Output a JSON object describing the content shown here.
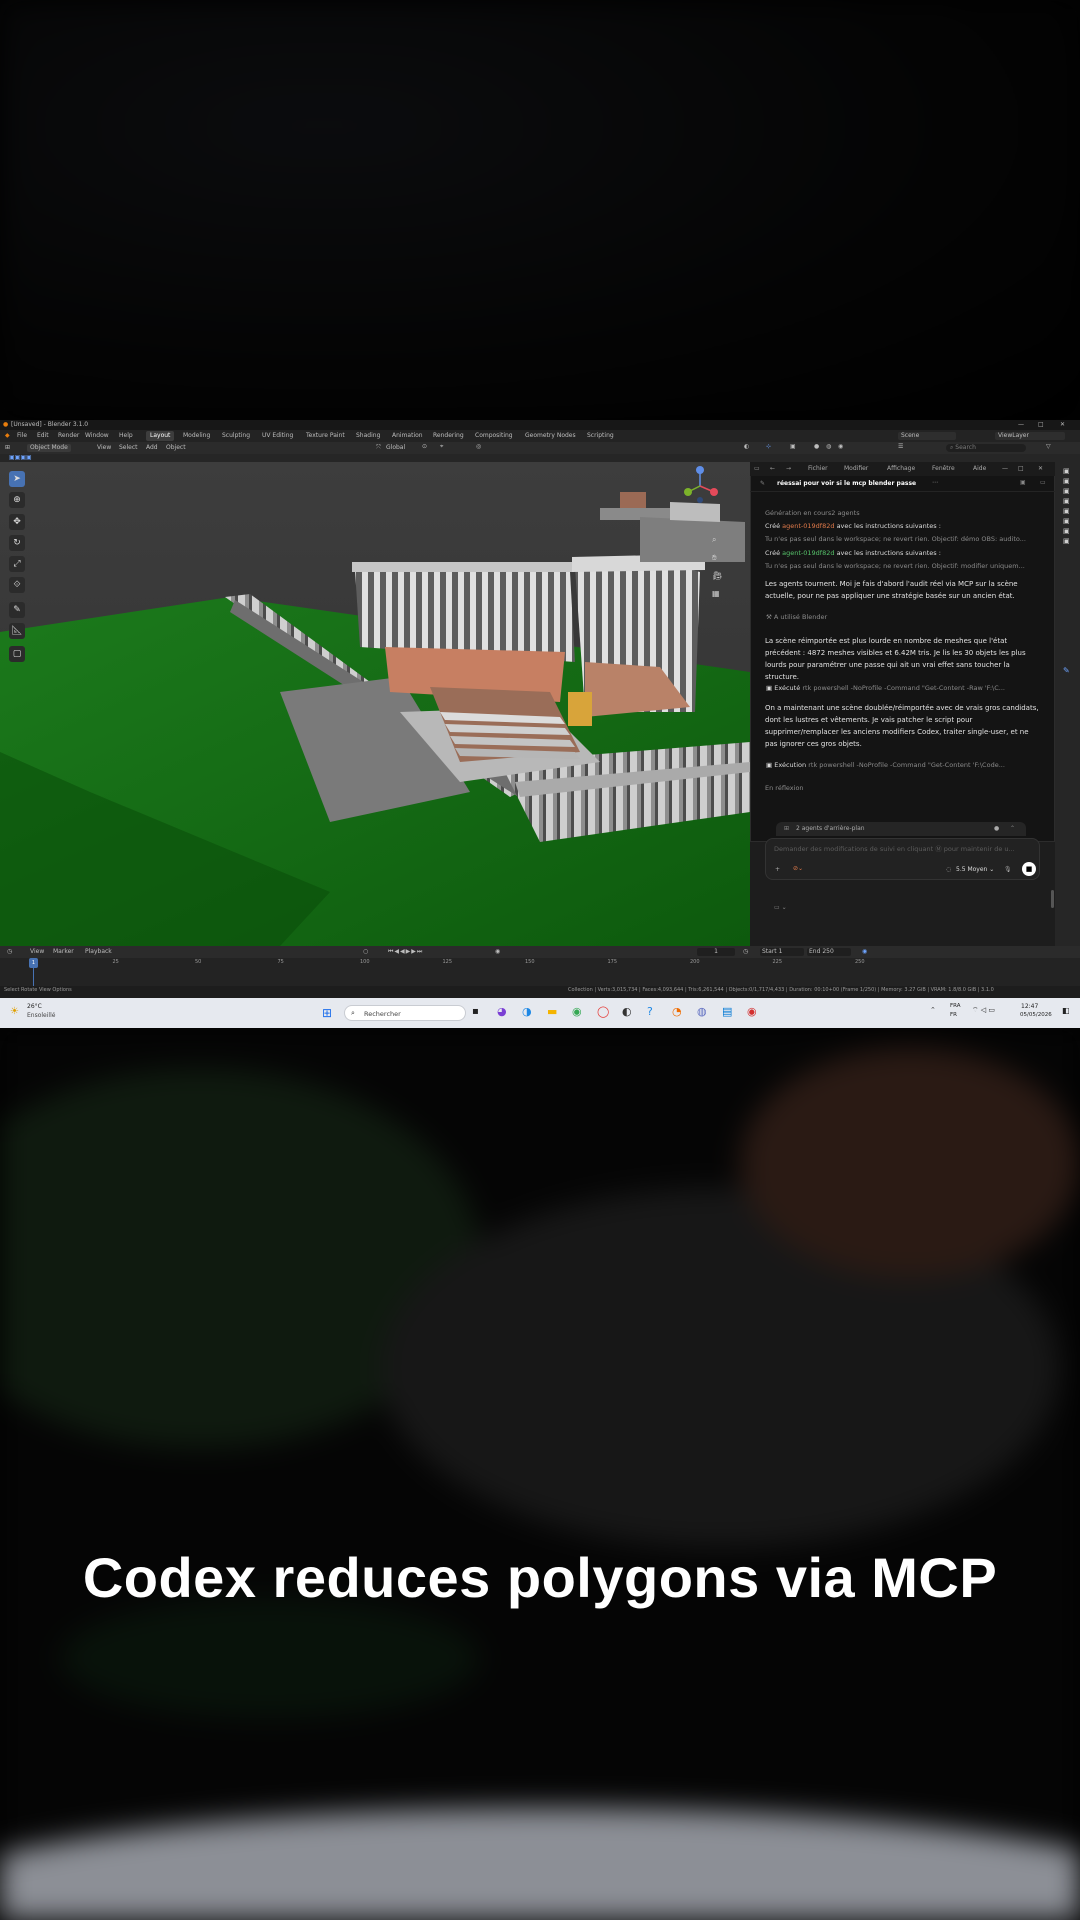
{
  "caption": "Codex reduces polygons via MCP",
  "window": {
    "title": "[Unsaved] - Blender 3.1.0",
    "minimize": "—",
    "maximize": "□",
    "close": "✕"
  },
  "menu": [
    "File",
    "Edit",
    "Render",
    "Window",
    "Help"
  ],
  "workspace_tabs": [
    "Layout",
    "Modeling",
    "Sculpting",
    "UV Editing",
    "Texture Paint",
    "Shading",
    "Animation",
    "Rendering",
    "Compositing",
    "Geometry Nodes",
    "Scripting"
  ],
  "scene": {
    "name": "Scene",
    "view_layer": "ViewLayer"
  },
  "viewport": {
    "mode": "Object Mode",
    "menus": [
      "View",
      "Select",
      "Add",
      "Object"
    ],
    "orientation": "Global"
  },
  "outliner": {
    "search_placeholder": "Search"
  },
  "codex": {
    "menus": [
      "Fichier",
      "Modifier",
      "Affichage",
      "Fenêtre",
      "Aide"
    ],
    "thread_title": "réessai pour voir si le mcp blender passe",
    "generation_status": "Génération en cours2 agents",
    "agents": [
      {
        "prefix": "Créé",
        "id": "agent-019df82d",
        "suffix": "avec les instructions suivantes :",
        "detail": "Tu n'es pas seul dans le workspace; ne revert rien. Objectif: démo OBS: audito..."
      },
      {
        "prefix": "Créé",
        "id": "agent-019df82d",
        "suffix": "avec les instructions suivantes :",
        "detail": "Tu n'es pas seul dans le workspace; ne revert rien. Objectif: modifier uniquem..."
      }
    ],
    "paragraphs": [
      "Les agents tournent. Moi je fais d'abord l'audit réel via MCP sur la scène actuelle, pour ne pas appliquer une stratégie basée sur un ancien état.",
      "La scène réimportée est plus lourde en nombre de meshes que l'état précédent : 4872 meshes visibles et 6.42M tris. Je lis les 30 objets les plus lourds pour paramétrer une passe qui ait un vrai effet sans toucher la structure.",
      "On a maintenant une scène doublée/réimportée avec de vrais gros candidats, dont les lustres et vêtements. Je vais patcher le script pour supprimer/remplacer les anciens modifiers Codex, traiter single-user, et ne pas ignorer ces gros objets."
    ],
    "tool_used": "A utilisé Blender",
    "commands": [
      {
        "label": "Exécuté",
        "command": "rtk powershell -NoProfile -Command \"Get-Content -Raw 'F:\\C..."
      },
      {
        "label": "Exécution",
        "command": "rtk powershell -NoProfile -Command \"Get-Content 'F:\\Code..."
      }
    ],
    "thinking": "En réflexion",
    "background_agents": "2 agents d'arrière-plan",
    "composer_placeholder": "Demander des modifications de suivi en cliquant Ⓜ pour maintenir de u...",
    "model": "5.5 Moyen ⌄"
  },
  "timeline": {
    "menus": [
      "View",
      "Marker",
      "Playback"
    ],
    "current_frame": "1",
    "start_label": "Start",
    "start": "1",
    "end_label": "End",
    "end": "250",
    "ruler_ticks": [
      "0",
      "25",
      "50",
      "75",
      "100",
      "125",
      "150",
      "175",
      "200",
      "225",
      "250"
    ]
  },
  "status": {
    "hints": "Select   Rotate View   Options",
    "stats": "Collection | Verts:3,015,734 | Faces:4,093,644 | Tris:6,261,544 | Objects:0/1,717/4,433 | Duration: 00:10+00 (Frame 1/250) | Memory: 3.27 GiB | VRAM: 1.8/8.0 GiB | 3.1.0"
  },
  "taskbar": {
    "weather_temp": "26°C",
    "weather_text": "Ensoleillé",
    "search_placeholder": "Rechercher",
    "lang": "FRA",
    "layout": "FR",
    "time": "12:47",
    "date": "05/05/2026"
  }
}
